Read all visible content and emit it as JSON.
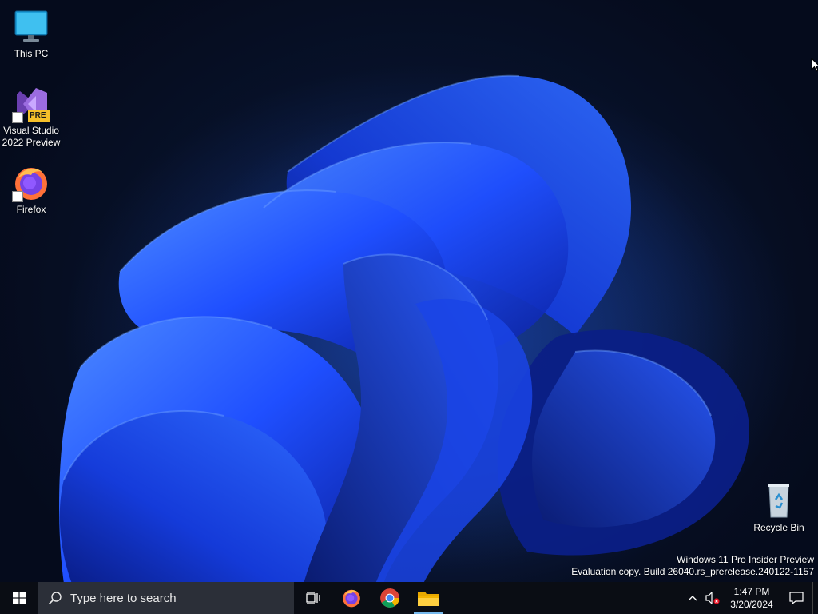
{
  "desktop": {
    "icons": [
      {
        "label": "This PC",
        "icon": "monitor-icon"
      },
      {
        "label_line1": "Visual Studio",
        "label_line2": "2022 Preview",
        "icon": "visual-studio-preview-icon",
        "badge": "PRE"
      },
      {
        "label": "Firefox",
        "icon": "firefox-icon"
      },
      {
        "label": "Recycle Bin",
        "icon": "recycle-bin-icon"
      }
    ],
    "watermark": {
      "line1": "Windows 11 Pro Insider Preview",
      "line2": "Evaluation copy. Build 26040.rs_prerelease.240122-1157"
    }
  },
  "taskbar": {
    "start_icon": "windows-logo-icon",
    "search_placeholder": "Type here to search",
    "search_icon": "search-icon",
    "task_view_icon": "task-view-icon",
    "pinned_apps": [
      {
        "icon": "firefox-icon",
        "active": false
      },
      {
        "icon": "chrome-icon",
        "active": false
      },
      {
        "icon": "file-explorer-icon",
        "active": true
      }
    ],
    "tray": {
      "chevron_icon": "chevron-up-icon",
      "volume_icon": "volume-muted-icon",
      "time": "1:47 PM",
      "date": "3/20/2024",
      "notification_icon": "notification-icon"
    }
  },
  "colors": {
    "accent": "#76b9ed",
    "wallpaper_blue": "#1f4fff",
    "taskbar": "#0a0d14",
    "search_bg": "#2b2f38"
  }
}
